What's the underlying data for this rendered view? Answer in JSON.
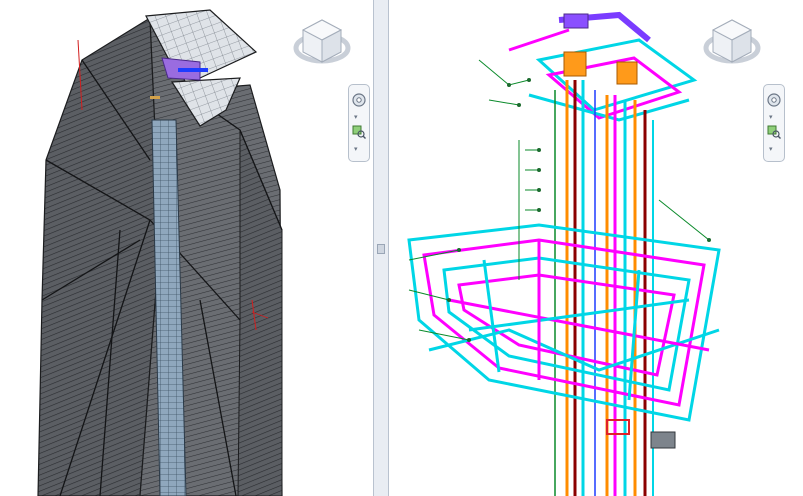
{
  "layout": {
    "mode": "two-pane-tiled-3d-views"
  },
  "left_view": {
    "subject": "building-envelope",
    "style": "shaded-with-edges",
    "facade_color": "#5b5e63",
    "edge_color": "#1c1d1f",
    "crown_glass_color": "#d9dde2",
    "core_color": "#9fb4c8"
  },
  "right_view": {
    "subject": "mep-systems",
    "style": "wireframe-colored",
    "system_colors": [
      "#ff00ff",
      "#00d6e6",
      "#ff8c00",
      "#8b0000",
      "#0a8a2a",
      "#7a3cff",
      "#1e3cff"
    ]
  },
  "view_controls": {
    "viewcube_icon": "viewcube-icon",
    "steering_wheel_icon": "steering-wheel-icon",
    "zoom_icon": "zoom-icon",
    "chevron_icon": "chevron-down-icon"
  },
  "accent": "#6f8bb0"
}
